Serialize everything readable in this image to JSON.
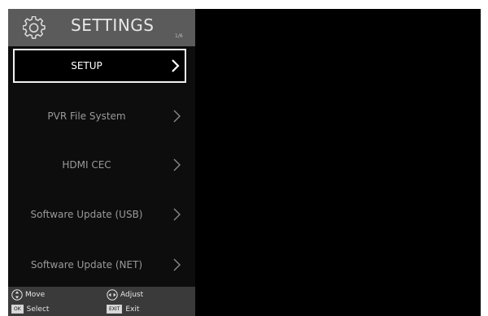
{
  "header": {
    "title": "SETTINGS",
    "page_indicator": "1/6",
    "icon": "gear-icon"
  },
  "menu": {
    "selected_index": 0,
    "items": [
      {
        "label": "SETUP"
      },
      {
        "label": "PVR File System"
      },
      {
        "label": "HDMI CEC"
      },
      {
        "label": "Software Update (USB)"
      },
      {
        "label": "Software Update (NET)"
      }
    ]
  },
  "footer": {
    "move": {
      "icon": "up-down-arrows-icon",
      "label": "Move"
    },
    "adjust": {
      "icon": "left-right-arrows-icon",
      "label": "Adjust"
    },
    "select": {
      "key": "OK",
      "label": "Select"
    },
    "exit": {
      "key": "EXIT",
      "label": "Exit"
    }
  },
  "colors": {
    "header_bg": "#5b5b5b",
    "panel_bg": "#0d0d0d",
    "footer_bg": "#3a3a3a",
    "selected_border": "#f2f2f2",
    "item_text": "#9a9a9a"
  }
}
